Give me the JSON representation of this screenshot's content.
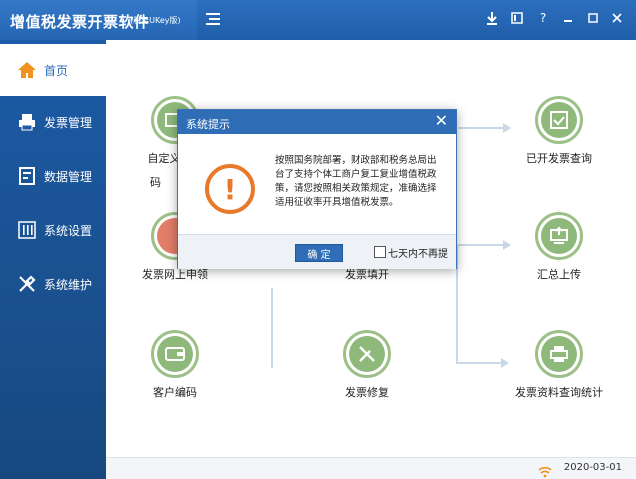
{
  "app": {
    "title": "增值税发票开票软件",
    "subtitle": "(税务UKey版)"
  },
  "sidebar": {
    "items": [
      {
        "label": "首页",
        "icon": "home-icon"
      },
      {
        "label": "发票管理",
        "icon": "printer-icon"
      },
      {
        "label": "数据管理",
        "icon": "database-icon"
      },
      {
        "label": "系统设置",
        "icon": "settings-sliders-icon"
      },
      {
        "label": "系统维护",
        "icon": "tools-icon"
      }
    ]
  },
  "features": {
    "col1_row1": "自定义货物",
    "col1_row1_cut": "码",
    "col1_row2": "发票网上申领",
    "col2_row2": "发票填开",
    "col3_row1": "已开发票查询",
    "col3_row2": "汇总上传",
    "col1_row3": "客户编码",
    "col2_row3": "发票修复",
    "col3_row3": "发票资料查询统计"
  },
  "status": {
    "date": "2020-03-01"
  },
  "dialog": {
    "title": "系统提示",
    "close": "✕",
    "message": "按照国务院部署，财政部和税务总局出台了支持个体工商户复工复业增值税政策，请您按照相关政策规定，准确选择适用征收率开具增值税发票。",
    "ok_label": "确 定",
    "checkbox_label": "七天内不再提"
  },
  "colors": {
    "primary": "#2f6db6",
    "sidebar": "#1d5ba6",
    "feature_green": "#8fb97a",
    "warning": "#e8782a"
  }
}
